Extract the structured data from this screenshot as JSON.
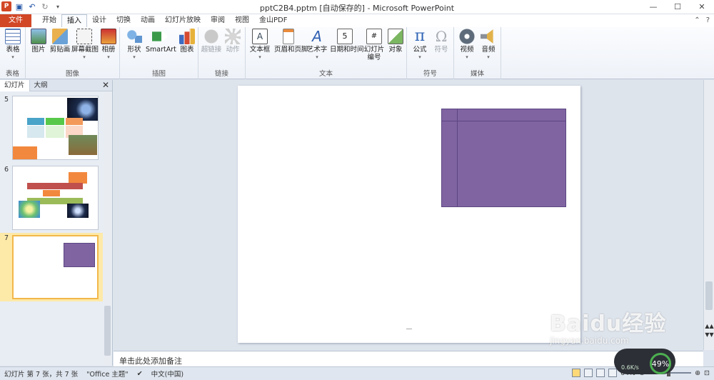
{
  "title_bar": {
    "title": "pptC2B4.pptm [自动保存的] - Microsoft PowerPoint",
    "minimize": "—",
    "maximize": "☐",
    "close": "✕",
    "app_icon": "P"
  },
  "tabs": [
    "开始",
    "插入",
    "设计",
    "切换",
    "动画",
    "幻灯片放映",
    "审阅",
    "视图",
    "金山PDF"
  ],
  "file_tab": "文件",
  "active_tab_index": 1,
  "ribbon": {
    "groups": [
      {
        "label": "表格",
        "buttons": [
          {
            "label": "表格",
            "icon": "table-icon"
          }
        ]
      },
      {
        "label": "图像",
        "buttons": [
          {
            "label": "图片",
            "icon": "picture-icon"
          },
          {
            "label": "剪贴画",
            "icon": "clipart-icon"
          },
          {
            "label": "屏幕截图",
            "icon": "screenshot-icon"
          },
          {
            "label": "相册",
            "icon": "album-icon"
          }
        ]
      },
      {
        "label": "插图",
        "buttons": [
          {
            "label": "形状",
            "icon": "shapes-icon"
          },
          {
            "label": "SmartArt",
            "icon": "smartart-icon"
          },
          {
            "label": "图表",
            "icon": "chart-icon"
          }
        ]
      },
      {
        "label": "链接",
        "buttons": [
          {
            "label": "超链接",
            "icon": "hyperlink-icon",
            "disabled": true
          },
          {
            "label": "动作",
            "icon": "action-icon",
            "disabled": true
          }
        ]
      },
      {
        "label": "文本",
        "buttons": [
          {
            "label": "文本框",
            "icon": "textbox-icon"
          },
          {
            "label": "页眉和页脚",
            "icon": "header-footer-icon"
          },
          {
            "label": "艺术字",
            "icon": "wordart-icon"
          },
          {
            "label": "日期和时间",
            "icon": "datetime-icon"
          },
          {
            "label": "幻灯片\n编号",
            "icon": "slide-number-icon"
          },
          {
            "label": "对象",
            "icon": "object-icon"
          }
        ]
      },
      {
        "label": "符号",
        "buttons": [
          {
            "label": "公式",
            "icon": "equation-icon"
          },
          {
            "label": "符号",
            "icon": "symbol-icon",
            "disabled": true
          }
        ]
      },
      {
        "label": "媒体",
        "buttons": [
          {
            "label": "视频",
            "icon": "video-icon"
          },
          {
            "label": "音频",
            "icon": "audio-icon"
          }
        ]
      }
    ]
  },
  "panel": {
    "tabs": [
      "幻灯片",
      "大纲"
    ],
    "close": "✕",
    "thumbnails": [
      {
        "number": "5"
      },
      {
        "number": "6"
      },
      {
        "number": "7",
        "selected": true
      }
    ]
  },
  "slide": {
    "shape_color": "#8064a2"
  },
  "notes": {
    "placeholder": "单击此处添加备注"
  },
  "status": {
    "slide_info": "幻灯片 第 7 张，共 7 张",
    "theme": "\"Office 主题\"",
    "language": "中文(中国)",
    "zoom": "64%"
  },
  "watermark": {
    "brand": "Baidu经验",
    "url": "jingyan.baidu.com"
  },
  "speed_widget": {
    "percent": "49%",
    "rate": "0.6K/s"
  }
}
